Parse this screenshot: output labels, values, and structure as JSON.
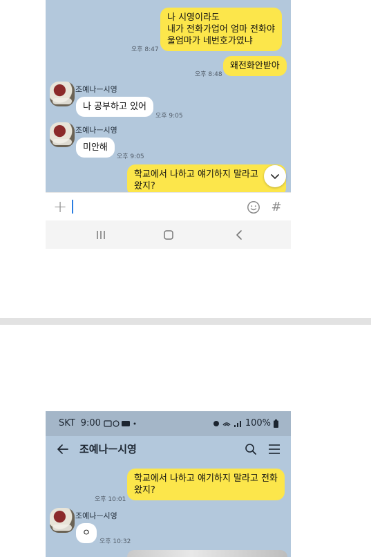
{
  "top_screen": {
    "messages": [
      {
        "kind": "mine",
        "lines": [
          "나 시영이라도",
          "내가 전화가업어  엄마 전화야",
          "울엄마가 네번호가였냐"
        ],
        "time": "오후 8:47"
      },
      {
        "kind": "mine",
        "lines": [
          "왜전화안받아"
        ],
        "time": "오후 8:48"
      },
      {
        "kind": "theirs",
        "sender": "조예나ㅡ시영",
        "lines": [
          "나 공부하고 있어"
        ],
        "time": "오후 9:05"
      },
      {
        "kind": "theirs",
        "sender": "조예나ㅡ시영",
        "lines": [
          "미안해"
        ],
        "time": "오후 9:05"
      },
      {
        "kind": "mine",
        "lines": [
          "학교에서 나하고 얘기하지 말라고",
          "왔지?"
        ],
        "time": ""
      }
    ],
    "input": {
      "placeholder": ""
    },
    "icons": {
      "attach": "plus-icon",
      "emoji": "emoji-icon",
      "hashtag": "hashtag-icon",
      "scroll_down": "chevron-down-icon",
      "nav_recent": "recent-apps-icon",
      "nav_home": "home-icon",
      "nav_back": "back-icon"
    },
    "glyphs": {
      "plus": "+",
      "hashtag": "#"
    }
  },
  "bottom_screen": {
    "status_bar": {
      "carrier": "SKT",
      "time": "9:00",
      "battery": "100%"
    },
    "header": {
      "title": "조예나ㅡ시영",
      "back_icon": "arrow-left-icon",
      "search_icon": "search-icon",
      "menu_icon": "hamburger-icon"
    },
    "messages": [
      {
        "kind": "mine",
        "lines": [
          "학교에서 나하고 얘기하지 말라고 전화",
          "왔지?"
        ],
        "time": "오후 10:01"
      },
      {
        "kind": "theirs",
        "sender": "조예나ㅡ시영",
        "lines": [
          "ㅇ"
        ],
        "time": "오후 10:32"
      }
    ]
  },
  "colors": {
    "chat_bg": "#b3c8dc",
    "mine_bubble": "#fce64b",
    "theirs_bubble": "#ffffff",
    "status_bar_bg": "#a4b6c8"
  }
}
